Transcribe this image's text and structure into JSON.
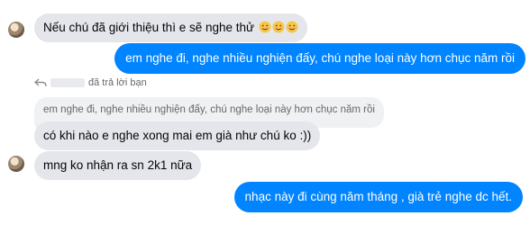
{
  "messages": {
    "m1": {
      "text": "Nếu chú đã giới thiệu thì e sẽ nghe thử",
      "emoji_count": 3,
      "emoji_icon": "smiling-face-emoji"
    },
    "m2": {
      "text": "em nghe đi, nghe nhiều nghiện đấy, chú nghe loại này hơn chục năm rồi"
    },
    "reply": {
      "label": "đã trả lời bạn",
      "quoted_text": "em nghe đi, nghe nhiều nghiện đấy, chú nghe loại này hơn chục năm rồi"
    },
    "m3": {
      "text": "có khi nào e nghe xong mai em già như chú ko :))"
    },
    "m4": {
      "text": "mng ko nhận ra sn 2k1 nữa"
    },
    "m5": {
      "text": "nhạc này đi cùng năm tháng ,  già trẻ nghe dc hết."
    }
  },
  "colors": {
    "outgoing": "#0084ff",
    "incoming": "#e4e6eb",
    "quoted": "#f0f1f3"
  }
}
